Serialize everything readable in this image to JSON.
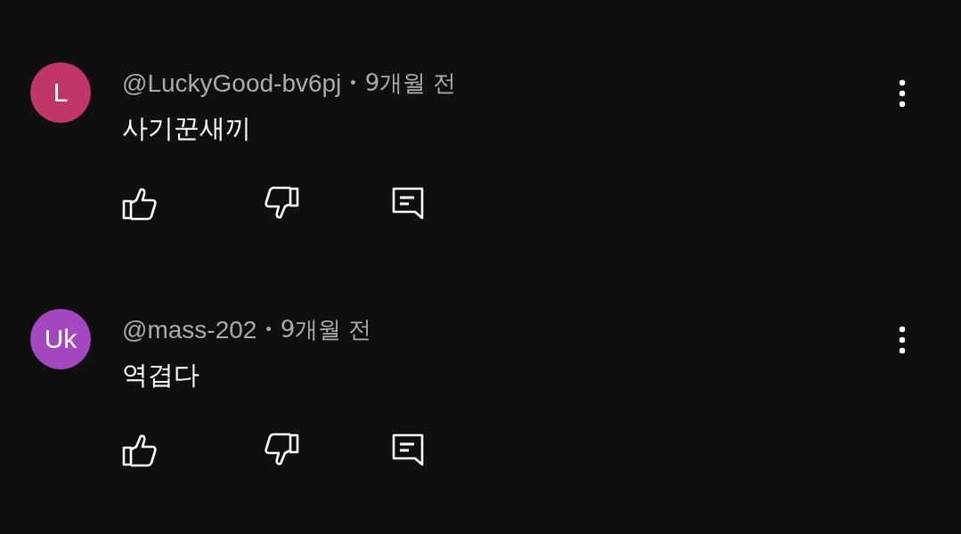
{
  "comments": [
    {
      "avatar_letter": "L",
      "color": "#c1366a",
      "author": "@LuckyGood-bv6pj",
      "separator": "•",
      "time": "9개월 전",
      "text": "사기꾼새끼"
    },
    {
      "avatar_letter": "Uk",
      "color": "#a448c0",
      "author": "@mass-202",
      "separator": "•",
      "time": "9개월 전",
      "text": "역겹다"
    }
  ]
}
